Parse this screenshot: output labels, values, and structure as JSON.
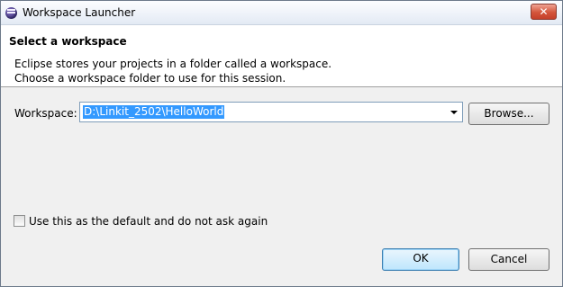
{
  "window": {
    "title": "Workspace Launcher",
    "close_label": "✕"
  },
  "header": {
    "section_title": "Select a workspace",
    "description_line1": "Eclipse stores your projects in a folder called a workspace.",
    "description_line2": "Choose a workspace folder to use for this session."
  },
  "workspace": {
    "label": "Workspace:",
    "value": "D:\\Linkit_2502\\HelloWorld",
    "browse_label": "Browse..."
  },
  "default_option": {
    "label": "Use this as the default and do not ask again",
    "checked": false
  },
  "buttons": {
    "ok_label": "OK",
    "cancel_label": "Cancel"
  },
  "colors": {
    "selection": "#3399ff",
    "close_button": "#c5402a"
  }
}
